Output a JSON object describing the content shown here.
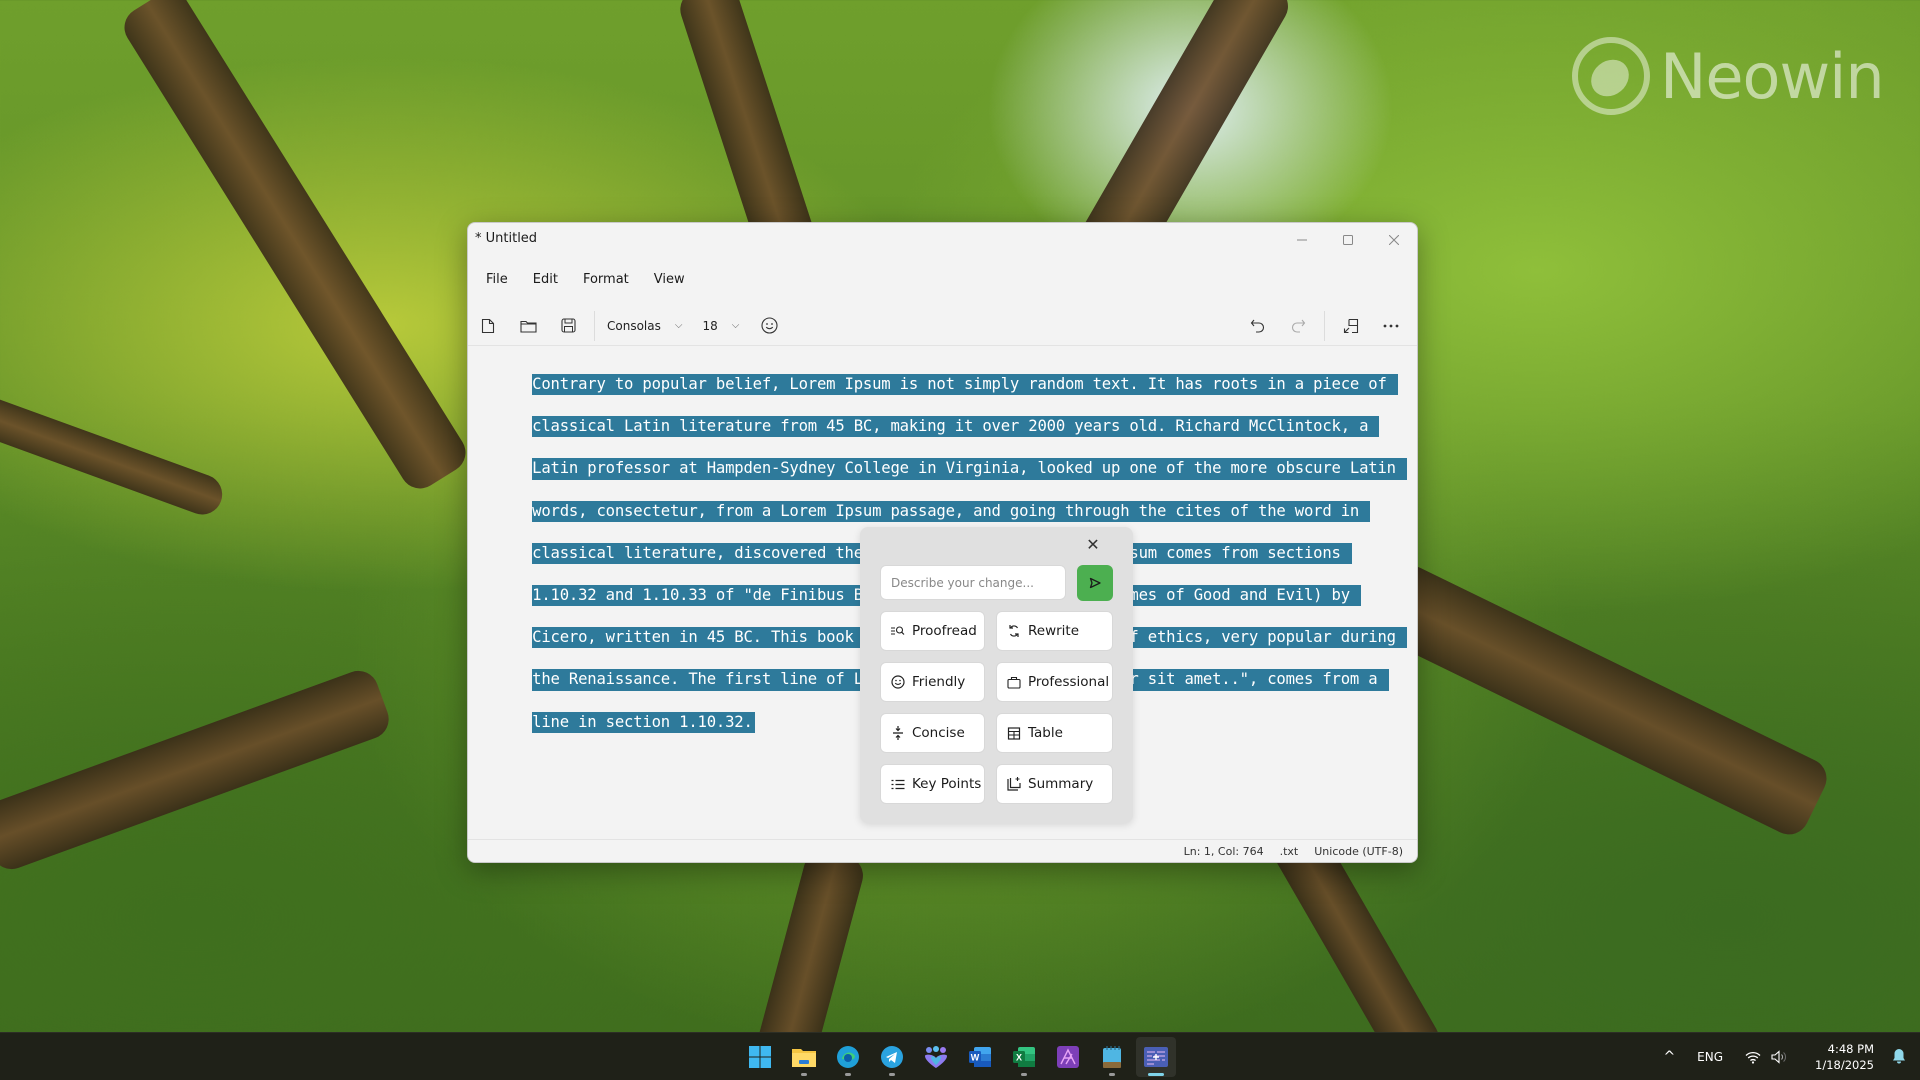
{
  "watermark": {
    "text": "Neowin"
  },
  "window": {
    "title": "* Untitled",
    "controls": {
      "minimize": "─",
      "maximize": "☐",
      "close": "✕"
    }
  },
  "menu": [
    "File",
    "Edit",
    "Format",
    "View"
  ],
  "toolbar": {
    "new_icon": "new-file-icon",
    "open_icon": "open-folder-icon",
    "save_icon": "save-icon",
    "font_family": "Consolas",
    "font_size": "18",
    "emoji_icon": "emoji-icon",
    "undo_icon": "undo-icon",
    "redo_icon": "redo-icon",
    "compact_icon": "compact-overlay-icon",
    "more_icon": "more-icon"
  },
  "editor": {
    "selection_color": "#2e7a9b",
    "lines": [
      "Contrary to popular belief, Lorem Ipsum is not simply random text. It has roots in a piece of ",
      "classical Latin literature from 45 BC, making it over 2000 years old. Richard McClintock, a ",
      "Latin professor at Hampden-Sydney College in Virginia, looked up one of the more obscure Latin ",
      "words, consectetur, from a Lorem Ipsum passage, and going through the cites of the word in ",
      "classical literature, discovered the undoubtable source. Lorem Ipsum comes from sections ",
      "1.10.32 and 1.10.33 of \"de Finibus Bonorum et Malorum\" (The Extremes of Good and Evil) by ",
      "Cicero, written in 45 BC. This book is a treatise on the theory of ethics, very popular during ",
      "the Renaissance. The first line of Lorem Ipsum, \"Lorem ipsum dolor sit amet..\", comes from a ",
      "line in section 1.10.32."
    ]
  },
  "ai_popup": {
    "close": "✕",
    "input_placeholder": "Describe your change...",
    "input_value": "",
    "send_color": "#4caf50",
    "actions": [
      {
        "label": "Proofread",
        "icon": "proofread-icon",
        "glyph": "≡🔍︎"
      },
      {
        "label": "Rewrite",
        "icon": "rewrite-icon",
        "glyph": "⟳"
      },
      {
        "label": "Friendly",
        "icon": "friendly-icon",
        "glyph": "☺"
      },
      {
        "label": "Professional",
        "icon": "briefcase-icon",
        "glyph": "▭"
      },
      {
        "label": "Concise",
        "icon": "concise-icon",
        "glyph": "≑"
      },
      {
        "label": "Table",
        "icon": "table-icon",
        "glyph": "⊞"
      },
      {
        "label": "Key Points",
        "icon": "list-icon",
        "glyph": "≡"
      },
      {
        "label": "Summary",
        "icon": "summary-icon",
        "glyph": "⎘"
      }
    ]
  },
  "statusbar": {
    "position": "Ln: 1, Col: 764",
    "file_type": ".txt",
    "encoding": "Unicode (UTF-8)"
  },
  "taskbar": {
    "apps": [
      {
        "name": "start",
        "color": "#3fb8f0",
        "running": false
      },
      {
        "name": "file-explorer",
        "color": "#f5c542",
        "running": true
      },
      {
        "name": "edge",
        "color": "#1fa0d8",
        "running": true
      },
      {
        "name": "telegram",
        "color": "#2aa3e0",
        "running": true
      },
      {
        "name": "teams-family",
        "color": "#8d7bf0",
        "running": false
      },
      {
        "name": "word",
        "color": "#2b65c9",
        "running": false
      },
      {
        "name": "excel",
        "color": "#1f8a4c",
        "running": true
      },
      {
        "name": "affinity",
        "color": "#8a3fb8",
        "running": false
      },
      {
        "name": "notepad",
        "color": "#4fb6e3",
        "running": true
      },
      {
        "name": "active-app",
        "color": "#5b6fc9",
        "running": true,
        "active": true
      }
    ],
    "tray": {
      "chevron": "^",
      "language": "ENG",
      "time": "4:48 PM",
      "date": "1/18/2025"
    }
  }
}
